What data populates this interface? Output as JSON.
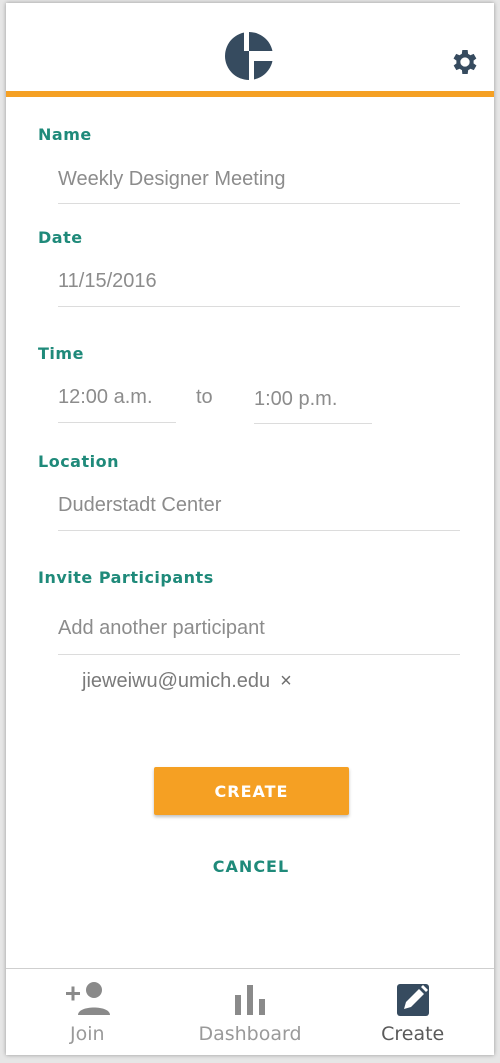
{
  "colors": {
    "accent": "#f5a023",
    "label": "#1f8a7a",
    "icon_dark": "#364b5f",
    "tab_inactive": "#8a8a8a"
  },
  "header": {
    "logo": "app-logo",
    "settings_icon": "gear-icon"
  },
  "form": {
    "name": {
      "label": "Name",
      "value": "Weekly Designer Meeting"
    },
    "date": {
      "label": "Date",
      "value": "11/15/2016"
    },
    "time": {
      "label": "Time",
      "start": "12:00 a.m.",
      "separator": "to",
      "end": "1:00 p.m."
    },
    "location": {
      "label": "Location",
      "value": "Duderstadt Center"
    },
    "participants": {
      "label": "Invite Participants",
      "placeholder": "Add another participant",
      "chips": [
        "jieweiwu@umich.edu"
      ],
      "remove_glyph": "×"
    }
  },
  "actions": {
    "create_label": "CREATE",
    "cancel_label": "CANCEL"
  },
  "tabs": [
    {
      "label": "Join",
      "icon": "add-person-icon",
      "active": false
    },
    {
      "label": "Dashboard",
      "icon": "bar-chart-icon",
      "active": false
    },
    {
      "label": "Create",
      "icon": "edit-icon",
      "active": true
    }
  ]
}
